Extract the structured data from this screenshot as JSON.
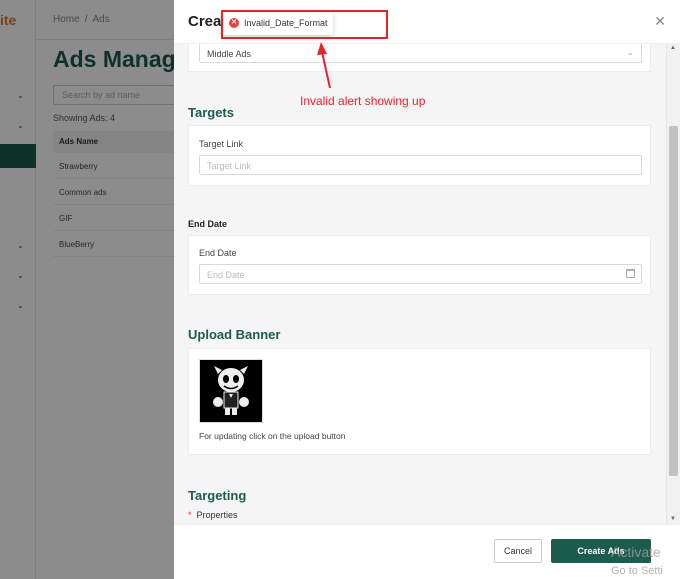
{
  "background": {
    "logo_text": "ite",
    "breadcrumb": [
      "Home",
      "Ads"
    ],
    "breadcrumb_sep": "/",
    "page_title": "Ads Manage",
    "search_placeholder": "Search by ad name",
    "showing": "Showing Ads: 4",
    "table_header": "Ads Name",
    "rows": [
      "Strawberry",
      "Common ads",
      "GIF",
      "BlueBerry"
    ]
  },
  "drawer": {
    "title": "Crea",
    "placement_value": "Middle Ads",
    "targets_title": "Targets",
    "target_link_label": "Target Link",
    "target_link_placeholder": "Target Link",
    "end_date_title": "End Date",
    "end_date_label": "End Date",
    "end_date_placeholder": "End Date",
    "upload_title": "Upload Banner",
    "upload_note": "For updating click on the upload button",
    "targeting_title": "Targeting",
    "properties_label": "Properties",
    "cancel_label": "Cancel",
    "create_label": "Create Ads"
  },
  "toast": {
    "message": "Invalid_Date_Format",
    "icon": "error-icon"
  },
  "annotation": {
    "text": "Invalid alert showing up",
    "color": "#e5232b"
  },
  "watermark": {
    "line1": "Activate",
    "line2": "Go to Setti"
  },
  "colors": {
    "brand": "#1b5c4c",
    "error": "#e8423f"
  }
}
